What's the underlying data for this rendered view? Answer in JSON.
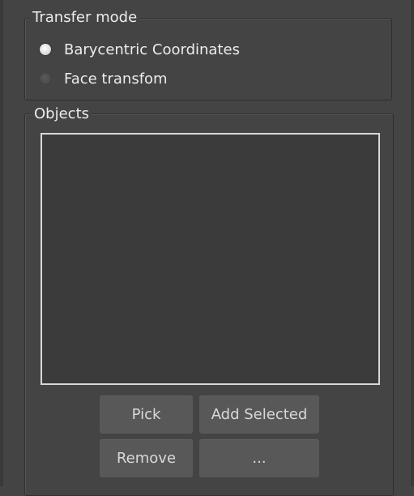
{
  "transfer_mode": {
    "title": "Transfer mode",
    "options": [
      {
        "label": "Barycentric Coordinates",
        "selected": true
      },
      {
        "label": "Face transfom",
        "selected": false
      }
    ]
  },
  "objects": {
    "title": "Objects",
    "list_items": [],
    "buttons": {
      "pick": "Pick",
      "add_selected": "Add Selected",
      "remove": "Remove",
      "more": "..."
    }
  }
}
